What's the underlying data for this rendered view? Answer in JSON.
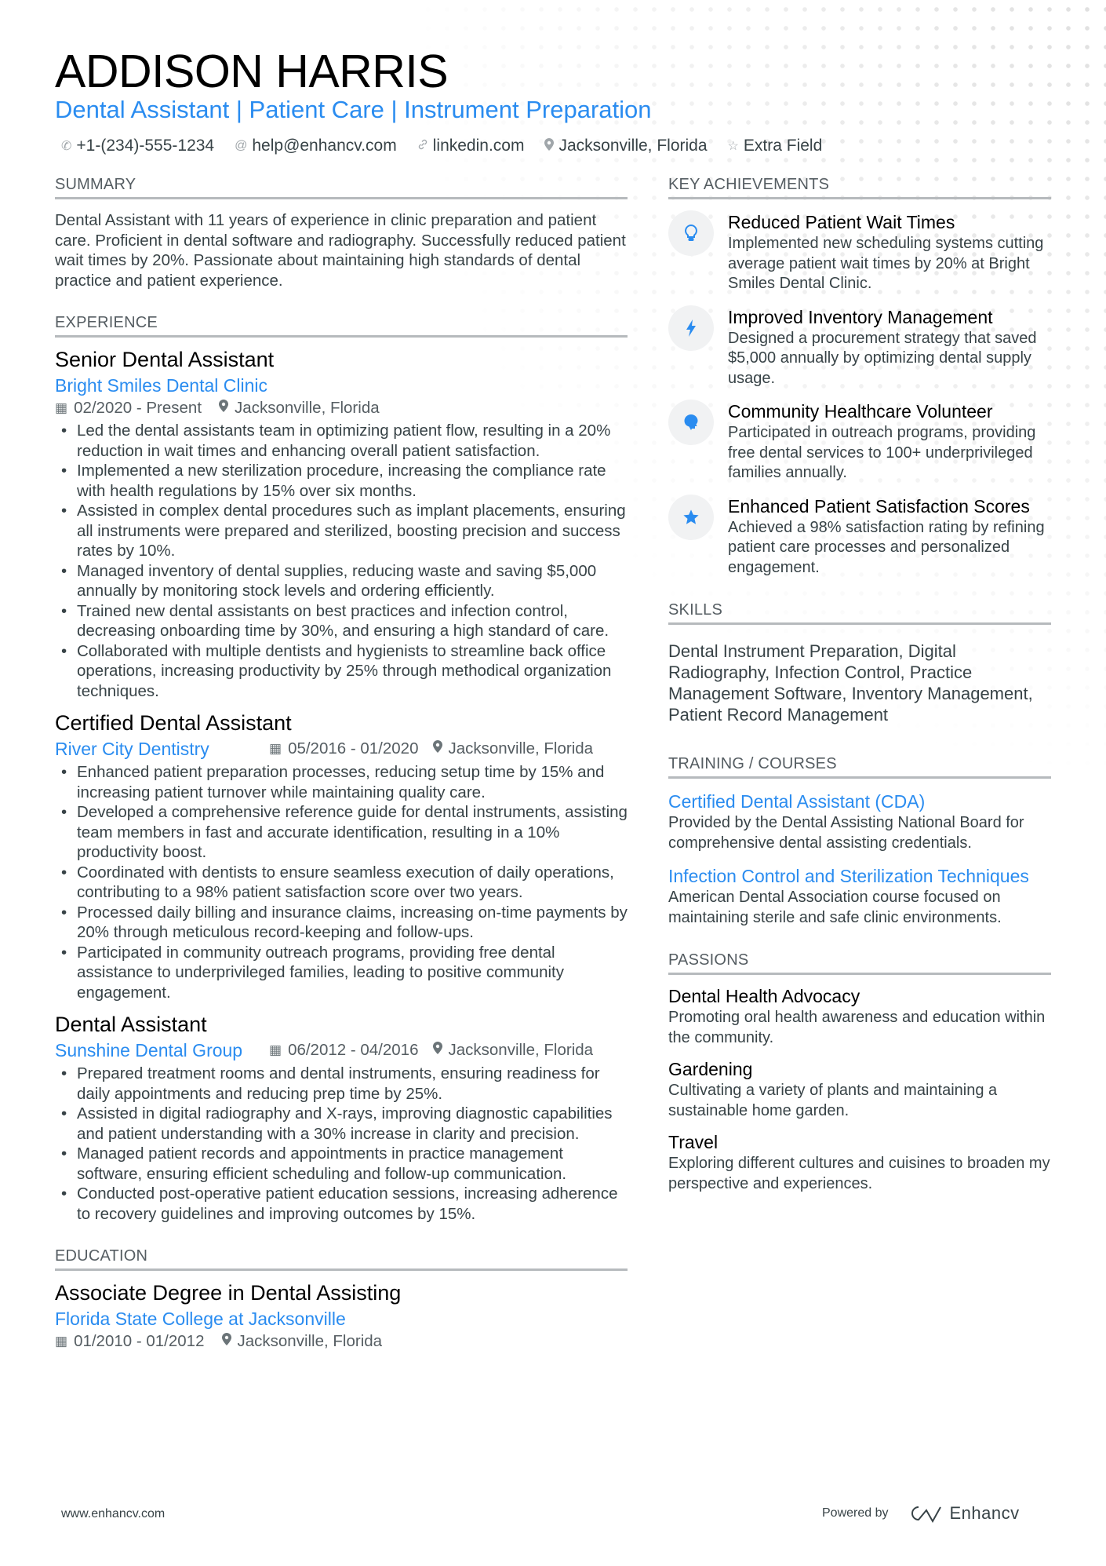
{
  "header": {
    "name": "ADDISON HARRIS",
    "title": "Dental Assistant | Patient Care | Instrument Preparation",
    "contacts": [
      {
        "icon": "phone-icon",
        "glyph": "✆",
        "text": "+1-(234)-555-1234"
      },
      {
        "icon": "at-icon",
        "glyph": "@",
        "text": "help@enhancv.com"
      },
      {
        "icon": "link-icon",
        "glyph": "🔗",
        "text": "linkedin.com"
      },
      {
        "icon": "location-icon",
        "glyph": "📍",
        "text": "Jacksonville, Florida"
      },
      {
        "icon": "star-outline-icon",
        "glyph": "☆",
        "text": "Extra Field"
      }
    ]
  },
  "summary": {
    "heading": "SUMMARY",
    "text": "Dental Assistant with 11 years of experience in clinic preparation and patient care. Proficient in dental software and radiography. Successfully reduced patient wait times by 20%. Passionate about maintaining high standards of dental practice and patient experience."
  },
  "experience": {
    "heading": "EXPERIENCE",
    "jobs": [
      {
        "title": "Senior Dental Assistant",
        "company": "Bright Smiles Dental Clinic",
        "dates": "02/2020 - Present",
        "location": "Jacksonville, Florida",
        "bullets": [
          "Led the dental assistants team in optimizing patient flow, resulting in a 20% reduction in wait times and enhancing overall patient satisfaction.",
          "Implemented a new sterilization procedure, increasing the compliance rate with health regulations by 15% over six months.",
          "Assisted in complex dental procedures such as implant placements, ensuring all instruments were prepared and sterilized, boosting precision and success rates by 10%.",
          "Managed inventory of dental supplies, reducing waste and saving $5,000 annually by monitoring stock levels and ordering efficiently.",
          "Trained new dental assistants on best practices and infection control, decreasing onboarding time by 30%, and ensuring a high standard of care.",
          "Collaborated with multiple dentists and hygienists to streamline back office operations, increasing productivity by 25% through methodical organization techniques."
        ]
      },
      {
        "title": "Certified Dental Assistant",
        "company": "River City Dentistry",
        "dates": "05/2016 - 01/2020",
        "location": "Jacksonville, Florida",
        "bullets": [
          "Enhanced patient preparation processes, reducing setup time by 15% and increasing patient turnover while maintaining quality care.",
          "Developed a comprehensive reference guide for dental instruments, assisting team members in fast and accurate identification, resulting in a 10% productivity boost.",
          "Coordinated with dentists to ensure seamless execution of daily operations, contributing to a 98% patient satisfaction score over two years.",
          "Processed daily billing and insurance claims, increasing on-time payments by 20% through meticulous record-keeping and follow-ups.",
          "Participated in community outreach programs, providing free dental assistance to underprivileged families, leading to positive community engagement."
        ]
      },
      {
        "title": "Dental Assistant",
        "company": "Sunshine Dental Group",
        "dates": "06/2012 - 04/2016",
        "location": "Jacksonville, Florida",
        "bullets": [
          "Prepared treatment rooms and dental instruments, ensuring readiness for daily appointments and reducing prep time by 25%.",
          "Assisted in digital radiography and X-rays, improving diagnostic capabilities and patient understanding with a 30% increase in clarity and precision.",
          "Managed patient records and appointments in practice management software, ensuring efficient scheduling and follow-up communication.",
          "Conducted post-operative patient education sessions, increasing adherence to recovery guidelines and improving outcomes by 15%."
        ]
      }
    ]
  },
  "education": {
    "heading": "EDUCATION",
    "degree": "Associate Degree in Dental Assisting",
    "school": "Florida State College at Jacksonville",
    "dates": "01/2010 - 01/2012",
    "location": "Jacksonville, Florida"
  },
  "achievements": {
    "heading": "KEY ACHIEVEMENTS",
    "items": [
      {
        "icon": "lightbulb-icon",
        "glyph": "💡",
        "title": "Reduced Patient Wait Times",
        "desc": "Implemented new scheduling systems cutting average patient wait times by 20% at Bright Smiles Dental Clinic."
      },
      {
        "icon": "lightning-icon",
        "glyph": "ϟ",
        "title": "Improved Inventory Management",
        "desc": "Designed a procurement strategy that saved $5,000 annually by optimizing dental supply usage."
      },
      {
        "icon": "head-brain-icon",
        "glyph": "☗",
        "title": "Community Healthcare Volunteer",
        "desc": "Participated in outreach programs, providing free dental services to 100+ underprivileged families annually."
      },
      {
        "icon": "star-icon",
        "glyph": "★",
        "title": "Enhanced Patient Satisfaction Scores",
        "desc": "Achieved a 98% satisfaction rating by refining patient care processes and personalized engagement."
      }
    ]
  },
  "skills": {
    "heading": "SKILLS",
    "text": "Dental Instrument Preparation, Digital Radiography, Infection Control, Practice Management Software, Inventory Management, Patient Record Management"
  },
  "training": {
    "heading": "TRAINING / COURSES",
    "items": [
      {
        "title": "Certified Dental Assistant (CDA)",
        "desc": "Provided by the Dental Assisting National Board for comprehensive dental assisting credentials."
      },
      {
        "title": "Infection Control and Sterilization Techniques",
        "desc": "American Dental Association course focused on maintaining sterile and safe clinic environments."
      }
    ]
  },
  "passions": {
    "heading": "PASSIONS",
    "items": [
      {
        "title": "Dental Health Advocacy",
        "desc": "Promoting oral health awareness and education within the community."
      },
      {
        "title": "Gardening",
        "desc": "Cultivating a variety of plants and maintaining a sustainable home garden."
      },
      {
        "title": "Travel",
        "desc": "Exploring different cultures and cuisines to broaden my perspective and experiences."
      }
    ]
  },
  "footer": {
    "website": "www.enhancv.com",
    "powered_by": "Powered by",
    "brand": "Enhancv"
  },
  "icons": {
    "calendar": "▦",
    "location": "⚲"
  },
  "colors": {
    "accent": "#2a8cf0",
    "text": "#384347",
    "heading_rule": "#b6babd"
  }
}
